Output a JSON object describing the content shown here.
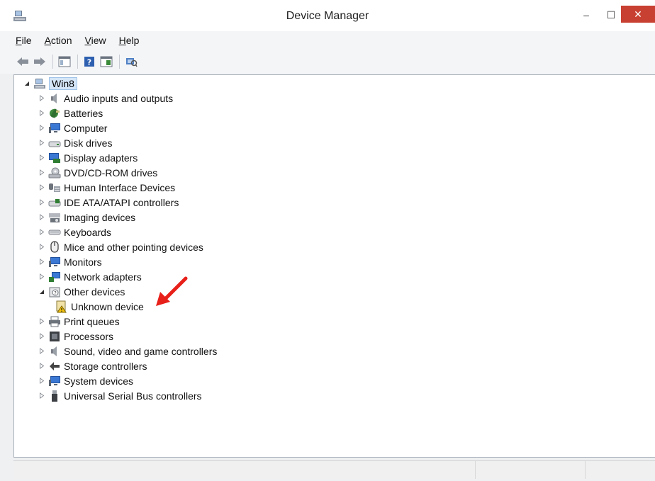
{
  "window": {
    "title": "Device Manager",
    "minimize": "–",
    "maximize": "☐",
    "close": "✕"
  },
  "menu": {
    "items": [
      {
        "underline": "F",
        "rest": "ile"
      },
      {
        "underline": "A",
        "rest": "ction"
      },
      {
        "underline": "V",
        "rest": "iew"
      },
      {
        "underline": "H",
        "rest": "elp"
      }
    ]
  },
  "toolbar": {
    "buttons": [
      "back-icon",
      "forward-icon",
      "properties-icon",
      "help-icon",
      "update-driver-icon",
      "scan-hardware-icon"
    ]
  },
  "tree": {
    "root": {
      "label": "Win8",
      "icon": "computer-icon",
      "expanded": true
    },
    "items": [
      {
        "label": "Audio inputs and outputs",
        "icon": "speaker-icon",
        "expanded": false
      },
      {
        "label": "Batteries",
        "icon": "battery-icon",
        "expanded": false
      },
      {
        "label": "Computer",
        "icon": "monitor-icon",
        "expanded": false
      },
      {
        "label": "Disk drives",
        "icon": "disk-icon",
        "expanded": false
      },
      {
        "label": "Display adapters",
        "icon": "display-adapter-icon",
        "expanded": false
      },
      {
        "label": "DVD/CD-ROM drives",
        "icon": "dvd-icon",
        "expanded": false
      },
      {
        "label": "Human Interface Devices",
        "icon": "hid-icon",
        "expanded": false
      },
      {
        "label": "IDE ATA/ATAPI controllers",
        "icon": "ide-icon",
        "expanded": false
      },
      {
        "label": "Imaging devices",
        "icon": "camera-icon",
        "expanded": false
      },
      {
        "label": "Keyboards",
        "icon": "keyboard-icon",
        "expanded": false
      },
      {
        "label": "Mice and other pointing devices",
        "icon": "mouse-icon",
        "expanded": false
      },
      {
        "label": "Monitors",
        "icon": "monitor-icon",
        "expanded": false
      },
      {
        "label": "Network adapters",
        "icon": "network-icon",
        "expanded": false
      },
      {
        "label": "Other devices",
        "icon": "unknown-device-category-icon",
        "expanded": true
      },
      {
        "label": "Unknown device",
        "icon": "warning-device-icon",
        "child": true
      },
      {
        "label": "Print queues",
        "icon": "printer-icon",
        "expanded": false
      },
      {
        "label": "Processors",
        "icon": "processor-icon",
        "expanded": false
      },
      {
        "label": "Sound, video and game controllers",
        "icon": "speaker-icon",
        "expanded": false
      },
      {
        "label": "Storage controllers",
        "icon": "storage-icon",
        "expanded": false
      },
      {
        "label": "System devices",
        "icon": "monitor-icon",
        "expanded": false
      },
      {
        "label": "Universal Serial Bus controllers",
        "icon": "usb-icon",
        "expanded": false
      }
    ]
  },
  "colors": {
    "close_button": "#c84031",
    "selection": "#d5e6f7",
    "annotation_arrow": "#e8201a"
  }
}
